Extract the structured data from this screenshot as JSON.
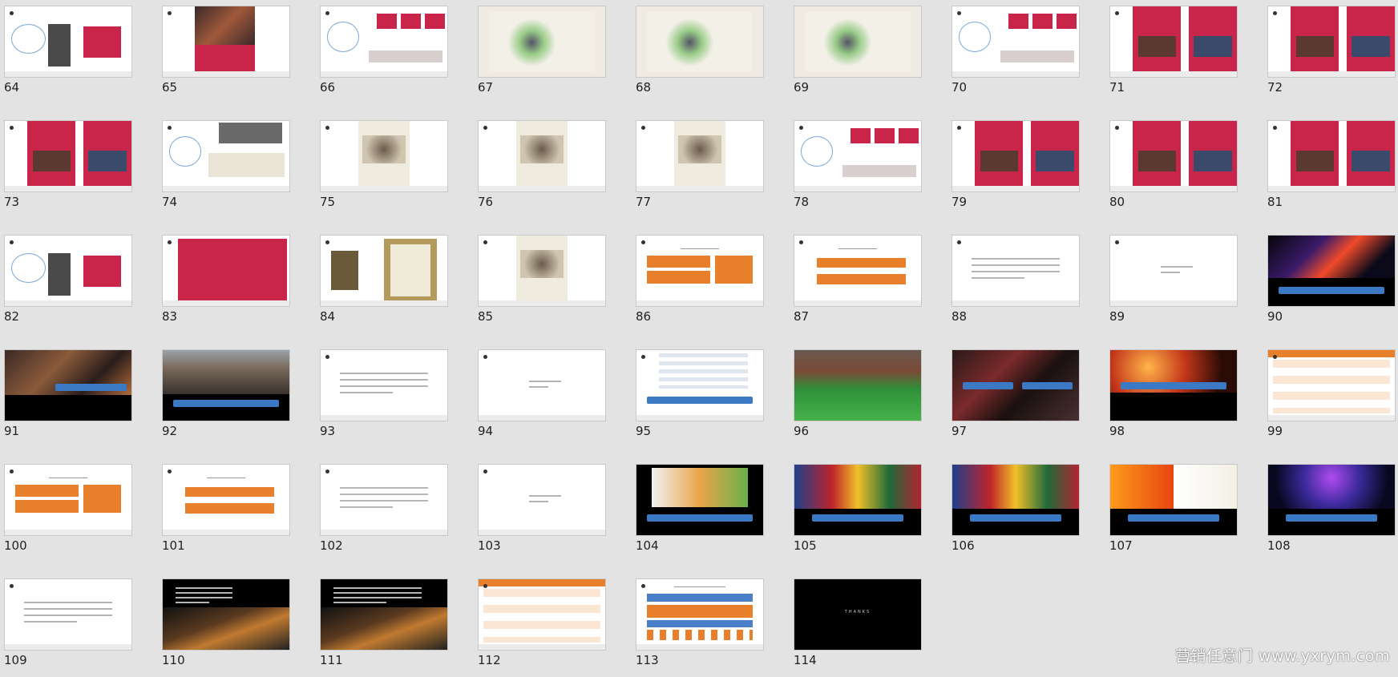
{
  "watermark": "营销任意门 www.yxrym.com",
  "slides": [
    {
      "n": "64",
      "t": "diagram-red"
    },
    {
      "n": "65",
      "t": "red-photo"
    },
    {
      "n": "66",
      "t": "diagram-boxes"
    },
    {
      "n": "67",
      "t": "cream-ink"
    },
    {
      "n": "68",
      "t": "cream-ink"
    },
    {
      "n": "69",
      "t": "cream-ink"
    },
    {
      "n": "70",
      "t": "diagram-boxes"
    },
    {
      "n": "71",
      "t": "red-double"
    },
    {
      "n": "72",
      "t": "red-double"
    },
    {
      "n": "73",
      "t": "red-double"
    },
    {
      "n": "74",
      "t": "diagram-photos"
    },
    {
      "n": "75",
      "t": "poster"
    },
    {
      "n": "76",
      "t": "poster"
    },
    {
      "n": "77",
      "t": "poster"
    },
    {
      "n": "78",
      "t": "diagram-boxes"
    },
    {
      "n": "79",
      "t": "red-double"
    },
    {
      "n": "80",
      "t": "red-double"
    },
    {
      "n": "81",
      "t": "red-double"
    },
    {
      "n": "82",
      "t": "diagram-red"
    },
    {
      "n": "83",
      "t": "red-banner"
    },
    {
      "n": "84",
      "t": "frame"
    },
    {
      "n": "85",
      "t": "poster"
    },
    {
      "n": "86",
      "t": "orange-chart"
    },
    {
      "n": "87",
      "t": "orange-chart2"
    },
    {
      "n": "88",
      "t": "text"
    },
    {
      "n": "89",
      "t": "text-small"
    },
    {
      "n": "90",
      "t": "neon"
    },
    {
      "n": "91",
      "t": "photo-cap"
    },
    {
      "n": "92",
      "t": "street"
    },
    {
      "n": "93",
      "t": "text"
    },
    {
      "n": "94",
      "t": "text-small"
    },
    {
      "n": "95",
      "t": "table-cap"
    },
    {
      "n": "96",
      "t": "field"
    },
    {
      "n": "97",
      "t": "crowd"
    },
    {
      "n": "98",
      "t": "fire"
    },
    {
      "n": "99",
      "t": "orange-table"
    },
    {
      "n": "100",
      "t": "orange-chart"
    },
    {
      "n": "101",
      "t": "orange-chart2"
    },
    {
      "n": "102",
      "t": "text"
    },
    {
      "n": "103",
      "t": "text-small"
    },
    {
      "n": "104",
      "t": "screen-black"
    },
    {
      "n": "105",
      "t": "festival"
    },
    {
      "n": "106",
      "t": "festival"
    },
    {
      "n": "107",
      "t": "new"
    },
    {
      "n": "108",
      "t": "concert"
    },
    {
      "n": "109",
      "t": "text"
    },
    {
      "n": "110",
      "t": "shop"
    },
    {
      "n": "111",
      "t": "shop2"
    },
    {
      "n": "112",
      "t": "orange-table"
    },
    {
      "n": "113",
      "t": "gantt"
    },
    {
      "n": "114",
      "t": "thanks"
    }
  ],
  "thanks_text": "THANKS"
}
